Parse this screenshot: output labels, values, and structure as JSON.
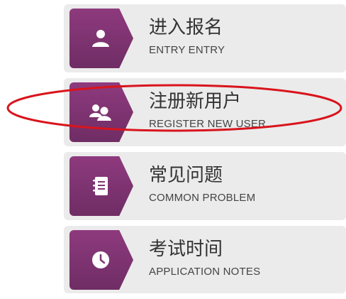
{
  "menu": {
    "items": [
      {
        "title": "进入报名",
        "subtitle": "ENTRY ENTRY",
        "icon": "user-icon"
      },
      {
        "title": "注册新用户",
        "subtitle": "REGISTER NEW USER",
        "icon": "users-icon"
      },
      {
        "title": "常见问题",
        "subtitle": "COMMON PROBLEM",
        "icon": "notebook-icon"
      },
      {
        "title": "考试时间",
        "subtitle": "APPLICATION NOTES",
        "icon": "clock-icon"
      }
    ]
  },
  "colors": {
    "tile": "#7f3471",
    "card_bg": "#ebebeb",
    "highlight_ring": "#d9141c"
  }
}
